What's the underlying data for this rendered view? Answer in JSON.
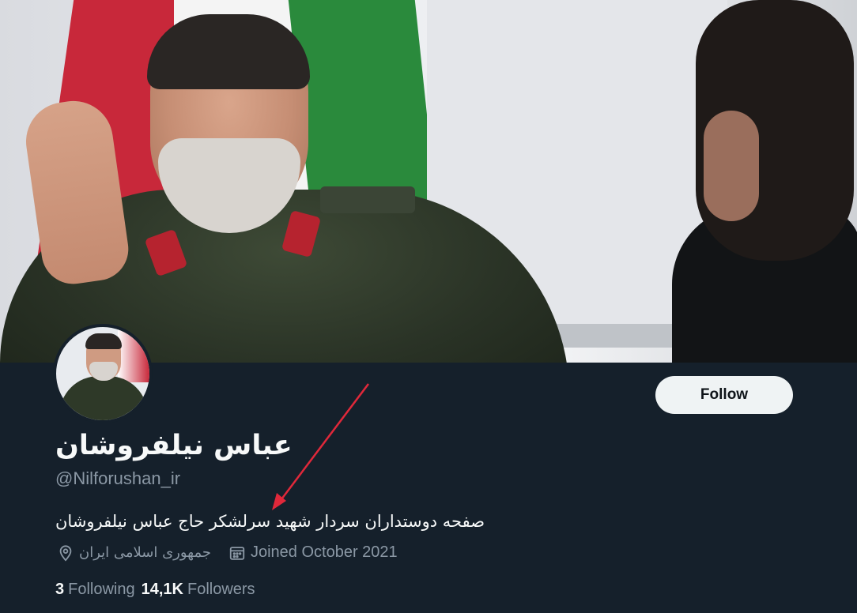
{
  "profile": {
    "display_name": "عباس نیلفروشان",
    "handle": "@Nilforushan_ir",
    "bio": "صفحه دوستداران سردار شهید سرلشکر حاج عباس نیلفروشان",
    "location": "جمهوری اسلامی ایران",
    "joined": "Joined October 2021"
  },
  "actions": {
    "follow_label": "Follow"
  },
  "stats": {
    "following_count": "3",
    "following_label": "Following",
    "followers_count": "14,1K",
    "followers_label": "Followers"
  },
  "icons": {
    "location": "location-pin-icon",
    "calendar": "calendar-icon"
  },
  "colors": {
    "background": "#15202b",
    "secondary_text": "#8b98a5",
    "follow_button": "#eff3f4",
    "annotation_arrow": "#e0283a"
  }
}
